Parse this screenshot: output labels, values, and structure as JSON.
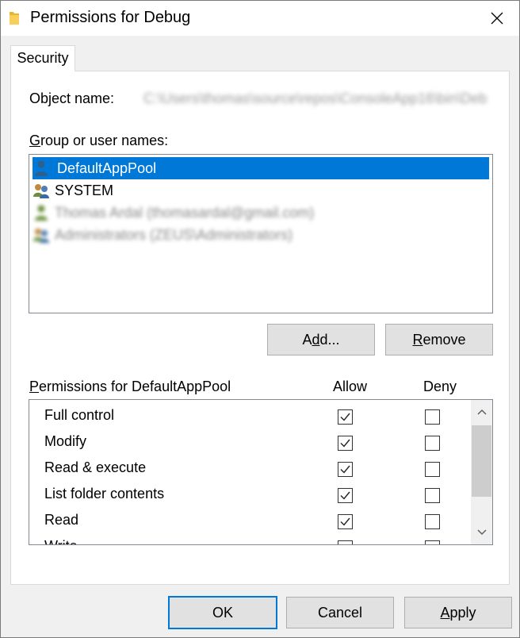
{
  "window": {
    "title": "Permissions for Debug"
  },
  "tabs": [
    {
      "label": "Security"
    }
  ],
  "object": {
    "label": "Object name:",
    "value": "C:\\Users\\thomas\\source\\repos\\ConsoleApp16\\bin\\Deb"
  },
  "group": {
    "label_prefix": "G",
    "label_rest": "roup or user names:",
    "users": [
      {
        "name": "DefaultAppPool",
        "icon": "user-icon",
        "selected": true
      },
      {
        "name": "SYSTEM",
        "icon": "users-group-icon",
        "selected": false
      },
      {
        "name": "Thomas Ardal (thomasardal@gmail.com)",
        "icon": "user-icon",
        "selected": false
      },
      {
        "name": "Administrators (ZEUS\\Administrators)",
        "icon": "users-group-icon",
        "selected": false
      }
    ]
  },
  "buttons": {
    "add_pre": "A",
    "add_u": "d",
    "add_post": "d...",
    "remove_u": "R",
    "remove_post": "emove",
    "ok": "OK",
    "cancel": "Cancel",
    "apply_u": "A",
    "apply_post": "pply"
  },
  "permissions": {
    "label_u": "P",
    "label_rest": "ermissions for DefaultAppPool",
    "allow_header": "Allow",
    "deny_header": "Deny",
    "rows": [
      {
        "name": "Full control",
        "allow": true,
        "deny": false
      },
      {
        "name": "Modify",
        "allow": true,
        "deny": false
      },
      {
        "name": "Read & execute",
        "allow": true,
        "deny": false
      },
      {
        "name": "List folder contents",
        "allow": true,
        "deny": false
      },
      {
        "name": "Read",
        "allow": true,
        "deny": false
      },
      {
        "name": "Write",
        "allow": false,
        "deny": false
      }
    ]
  },
  "colors": {
    "selection": "#0078d7",
    "window_bg": "#f0f0f0",
    "panel_bg": "#ffffff"
  }
}
